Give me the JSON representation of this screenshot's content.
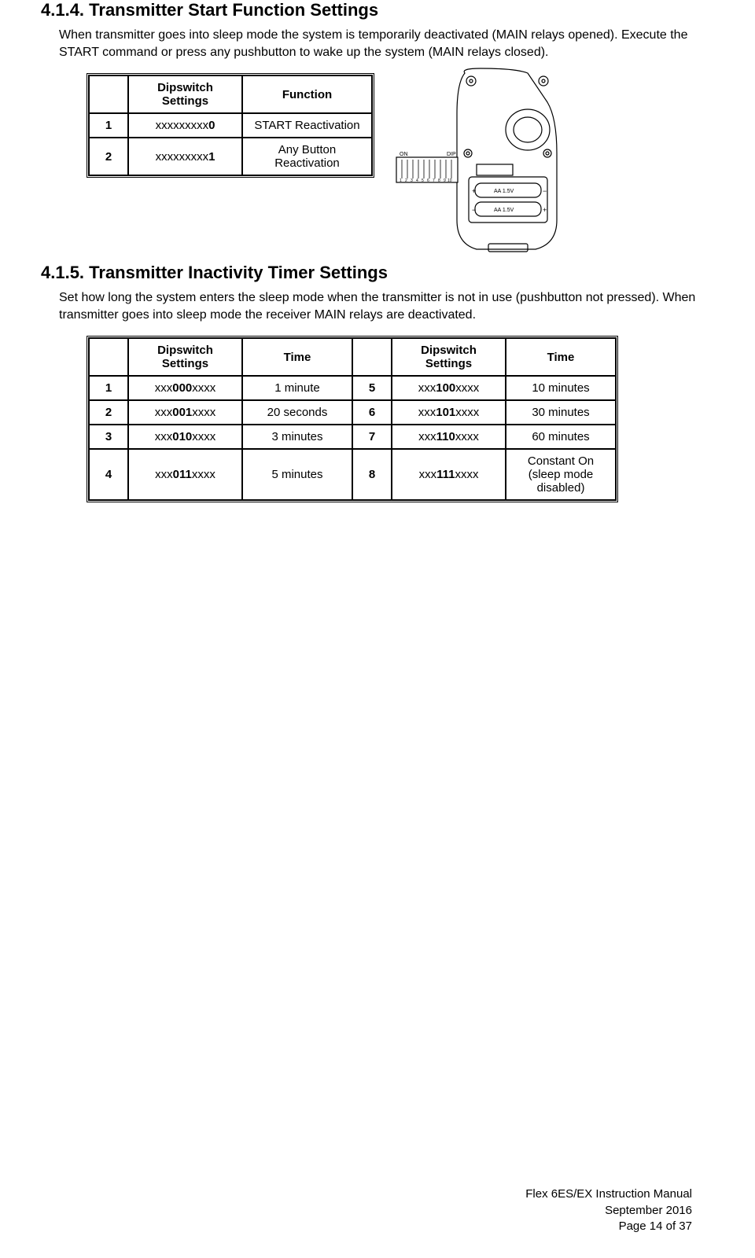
{
  "section414": {
    "heading": "4.1.4. Transmitter Start Function Settings",
    "body": "When transmitter goes into sleep mode the system is temporarily deactivated (MAIN relays opened).  Execute the START command or press any pushbutton to wake up the system (MAIN relays closed).",
    "table": {
      "headers": {
        "dip": "Dipswitch Settings",
        "func": "Function"
      },
      "rows": [
        {
          "n": "1",
          "dip_pre": "xxxxxxxxx",
          "dip_bold": "0",
          "func": "START Reactivation"
        },
        {
          "n": "2",
          "dip_pre": "xxxxxxxxx",
          "dip_bold": "1",
          "func": "Any Button Reactivation"
        }
      ]
    }
  },
  "section415": {
    "heading": "4.1.5. Transmitter Inactivity Timer Settings",
    "body": "Set how long the system enters the sleep mode when the transmitter is not in use (pushbutton not pressed).  When transmitter goes into sleep mode the receiver MAIN relays are deactivated.",
    "table": {
      "headers": {
        "dip": "Dipswitch Settings",
        "time": "Time"
      },
      "rows": [
        {
          "n1": "1",
          "dip1_pre": "xxx",
          "dip1_bold": "000",
          "dip1_post": "xxxx",
          "time1": "1 minute",
          "n2": "5",
          "dip2_pre": "xxx",
          "dip2_bold": "100",
          "dip2_post": "xxxx",
          "time2": "10 minutes"
        },
        {
          "n1": "2",
          "dip1_pre": "xxx",
          "dip1_bold": "001",
          "dip1_post": "xxxx",
          "time1": "20 seconds",
          "n2": "6",
          "dip2_pre": "xxx",
          "dip2_bold": "101",
          "dip2_post": "xxxx",
          "time2": "30 minutes"
        },
        {
          "n1": "3",
          "dip1_pre": "xxx",
          "dip1_bold": "010",
          "dip1_post": "xxxx",
          "time1": "3 minutes",
          "n2": "7",
          "dip2_pre": "xxx",
          "dip2_bold": "110",
          "dip2_post": "xxxx",
          "time2": "60 minutes"
        },
        {
          "n1": "4",
          "dip1_pre": "xxx",
          "dip1_bold": "011",
          "dip1_post": "xxxx",
          "time1": "5 minutes",
          "n2": "8",
          "dip2_pre": "xxx",
          "dip2_bold": "111",
          "dip2_post": "xxxx",
          "time2": "Constant On (sleep mode disabled)"
        }
      ]
    }
  },
  "footer": {
    "line1": "Flex 6ES/EX Instruction Manual",
    "line2": "September 2016",
    "line3": "Page 14 of 37"
  },
  "device_labels": {
    "on": "ON",
    "dip": "DIP",
    "batt1": "AA 1.5V",
    "batt2": "AA 1.5V"
  }
}
